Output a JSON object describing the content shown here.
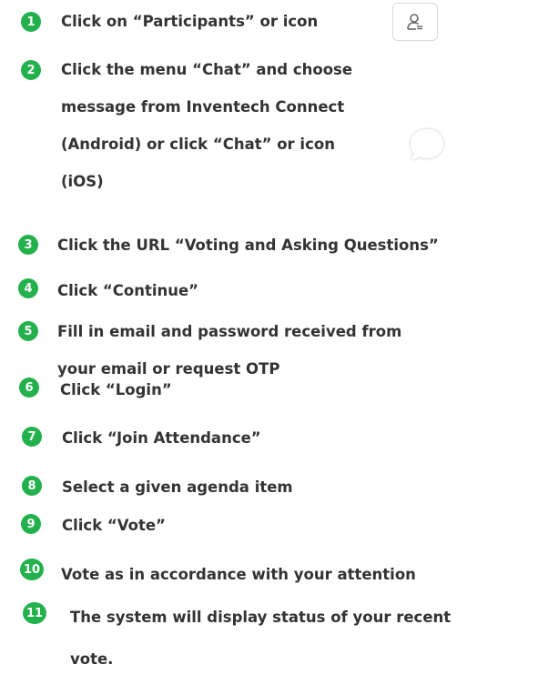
{
  "steps": [
    {
      "num": "1",
      "lines": [
        "Click on “Participants” or icon"
      ]
    },
    {
      "num": "2",
      "lines": [
        "Click the menu “Chat” and choose",
        "message from Inventech Connect",
        "(Android) or click “Chat” or icon",
        "(iOS)"
      ]
    },
    {
      "num": "3",
      "lines": [
        "Click the URL “Voting and Asking Questions”"
      ]
    },
    {
      "num": "4",
      "lines": [
        "Click “Continue”"
      ]
    },
    {
      "num": "5",
      "lines": [
        "Fill in email and password received from",
        "your email or request OTP"
      ]
    },
    {
      "num": "6",
      "lines": [
        "Click “Login”"
      ]
    },
    {
      "num": "7",
      "lines": [
        "Click “Join Attendance”"
      ]
    },
    {
      "num": "8",
      "lines": [
        "Select a given agenda item"
      ]
    },
    {
      "num": "9",
      "lines": [
        "Click “Vote”"
      ]
    },
    {
      "num": "10",
      "lines": [
        "Vote as in accordance with your attention"
      ]
    },
    {
      "num": "11",
      "lines": [
        "The system will display status of your recent",
        "vote."
      ]
    }
  ],
  "icons": {
    "participants": "participants-icon",
    "chat": "chat-bubble-icon"
  },
  "colors": {
    "badge": "#22b14c",
    "text": "#333333"
  }
}
